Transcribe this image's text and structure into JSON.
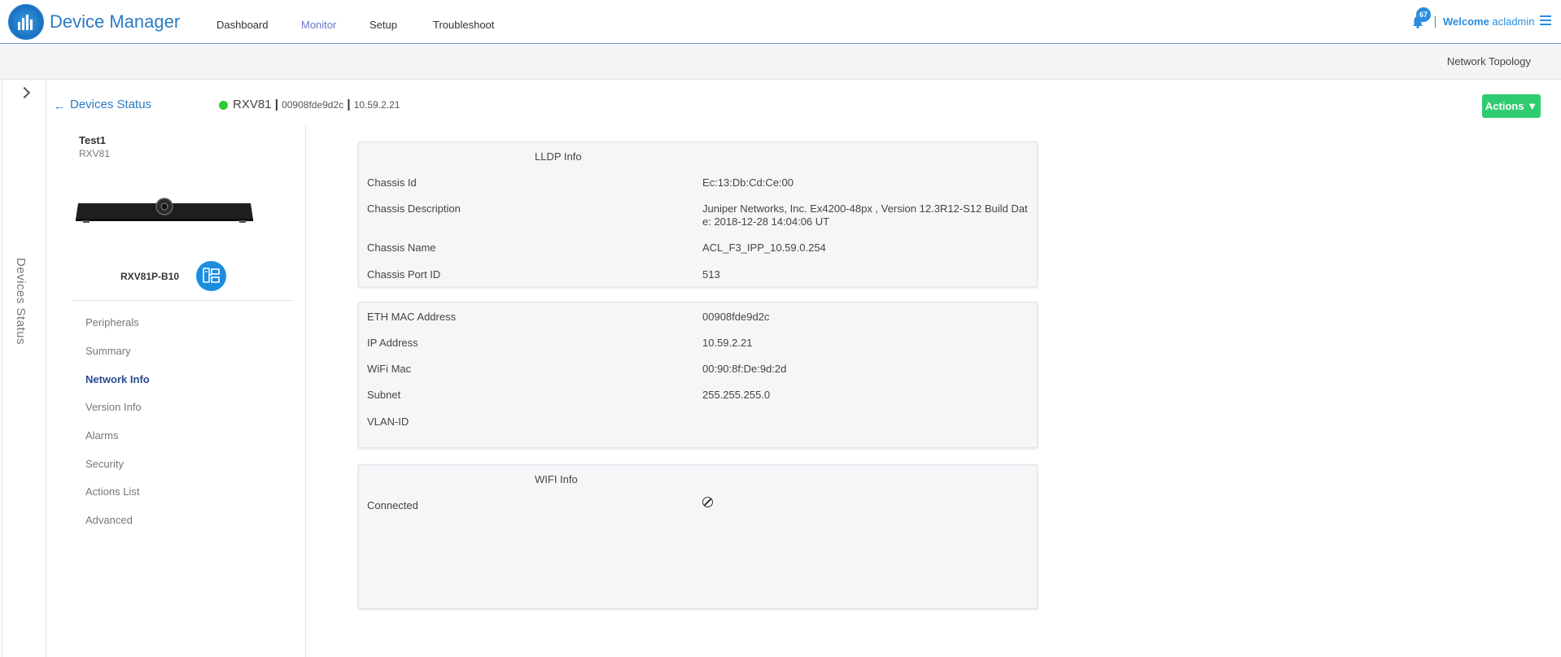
{
  "app": {
    "title": "Device Manager",
    "nav": [
      "Dashboard",
      "Monitor",
      "Setup",
      "Troubleshoot"
    ],
    "active_nav": "Monitor",
    "notification_count": "67",
    "welcome": "Welcome",
    "user": "acladmin",
    "accent_color": "#2a7bc3"
  },
  "subbar": {
    "network_topology": "Network Topology"
  },
  "rail": {
    "label": "Devices Status"
  },
  "header": {
    "back_label": "Devices Status",
    "status_color": "#2ecc2e",
    "device_name": "RXV81",
    "mac": "00908fde9d2c",
    "ip": "10.59.2.21",
    "actions_label": "Actions ▼"
  },
  "device": {
    "title": "Test1",
    "subtitle": "RXV81",
    "model": "RXV81P-B10"
  },
  "menu": {
    "items": [
      "Peripherals",
      "Summary",
      "Network Info",
      "Version Info",
      "Alarms",
      "Security",
      "Actions List",
      "Advanced"
    ],
    "active": "Network Info"
  },
  "lldp": {
    "title": "LLDP Info",
    "rows": [
      {
        "label": "Chassis Id",
        "value": "Ec:13:Db:Cd:Ce:00"
      },
      {
        "label": "Chassis Description",
        "value": "Juniper Networks, Inc. Ex4200-48px , Version 12.3R12-S12 Build Date: 2018-12-28 14:04:06 UT"
      },
      {
        "label": "Chassis Name",
        "value": "ACL_F3_IPP_10.59.0.254"
      },
      {
        "label": "Chassis Port ID",
        "value": "513"
      }
    ]
  },
  "network": {
    "rows": [
      {
        "label": "ETH MAC Address",
        "value": "00908fde9d2c"
      },
      {
        "label": "IP Address",
        "value": "10.59.2.21"
      },
      {
        "label": "WiFi Mac",
        "value": "00:90:8f:De:9d:2d"
      },
      {
        "label": "Subnet",
        "value": "255.255.255.0"
      },
      {
        "label": "VLAN-ID",
        "value": ""
      }
    ]
  },
  "wifi": {
    "title": "WIFI Info",
    "rows": [
      {
        "label": "Connected",
        "icon": "no-entry-icon"
      }
    ]
  }
}
